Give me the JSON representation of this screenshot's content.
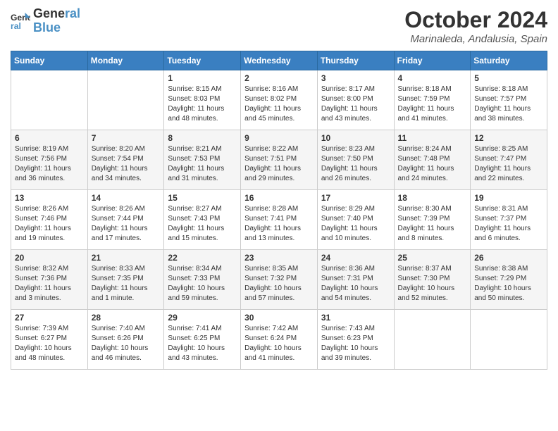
{
  "header": {
    "logo_line1": "General",
    "logo_line2": "Blue",
    "month": "October 2024",
    "location": "Marinaleda, Andalusia, Spain"
  },
  "days_of_week": [
    "Sunday",
    "Monday",
    "Tuesday",
    "Wednesday",
    "Thursday",
    "Friday",
    "Saturday"
  ],
  "weeks": [
    [
      {
        "day": "",
        "info": ""
      },
      {
        "day": "",
        "info": ""
      },
      {
        "day": "1",
        "info": "Sunrise: 8:15 AM\nSunset: 8:03 PM\nDaylight: 11 hours and 48 minutes."
      },
      {
        "day": "2",
        "info": "Sunrise: 8:16 AM\nSunset: 8:02 PM\nDaylight: 11 hours and 45 minutes."
      },
      {
        "day": "3",
        "info": "Sunrise: 8:17 AM\nSunset: 8:00 PM\nDaylight: 11 hours and 43 minutes."
      },
      {
        "day": "4",
        "info": "Sunrise: 8:18 AM\nSunset: 7:59 PM\nDaylight: 11 hours and 41 minutes."
      },
      {
        "day": "5",
        "info": "Sunrise: 8:18 AM\nSunset: 7:57 PM\nDaylight: 11 hours and 38 minutes."
      }
    ],
    [
      {
        "day": "6",
        "info": "Sunrise: 8:19 AM\nSunset: 7:56 PM\nDaylight: 11 hours and 36 minutes."
      },
      {
        "day": "7",
        "info": "Sunrise: 8:20 AM\nSunset: 7:54 PM\nDaylight: 11 hours and 34 minutes."
      },
      {
        "day": "8",
        "info": "Sunrise: 8:21 AM\nSunset: 7:53 PM\nDaylight: 11 hours and 31 minutes."
      },
      {
        "day": "9",
        "info": "Sunrise: 8:22 AM\nSunset: 7:51 PM\nDaylight: 11 hours and 29 minutes."
      },
      {
        "day": "10",
        "info": "Sunrise: 8:23 AM\nSunset: 7:50 PM\nDaylight: 11 hours and 26 minutes."
      },
      {
        "day": "11",
        "info": "Sunrise: 8:24 AM\nSunset: 7:48 PM\nDaylight: 11 hours and 24 minutes."
      },
      {
        "day": "12",
        "info": "Sunrise: 8:25 AM\nSunset: 7:47 PM\nDaylight: 11 hours and 22 minutes."
      }
    ],
    [
      {
        "day": "13",
        "info": "Sunrise: 8:26 AM\nSunset: 7:46 PM\nDaylight: 11 hours and 19 minutes."
      },
      {
        "day": "14",
        "info": "Sunrise: 8:26 AM\nSunset: 7:44 PM\nDaylight: 11 hours and 17 minutes."
      },
      {
        "day": "15",
        "info": "Sunrise: 8:27 AM\nSunset: 7:43 PM\nDaylight: 11 hours and 15 minutes."
      },
      {
        "day": "16",
        "info": "Sunrise: 8:28 AM\nSunset: 7:41 PM\nDaylight: 11 hours and 13 minutes."
      },
      {
        "day": "17",
        "info": "Sunrise: 8:29 AM\nSunset: 7:40 PM\nDaylight: 11 hours and 10 minutes."
      },
      {
        "day": "18",
        "info": "Sunrise: 8:30 AM\nSunset: 7:39 PM\nDaylight: 11 hours and 8 minutes."
      },
      {
        "day": "19",
        "info": "Sunrise: 8:31 AM\nSunset: 7:37 PM\nDaylight: 11 hours and 6 minutes."
      }
    ],
    [
      {
        "day": "20",
        "info": "Sunrise: 8:32 AM\nSunset: 7:36 PM\nDaylight: 11 hours and 3 minutes."
      },
      {
        "day": "21",
        "info": "Sunrise: 8:33 AM\nSunset: 7:35 PM\nDaylight: 11 hours and 1 minute."
      },
      {
        "day": "22",
        "info": "Sunrise: 8:34 AM\nSunset: 7:33 PM\nDaylight: 10 hours and 59 minutes."
      },
      {
        "day": "23",
        "info": "Sunrise: 8:35 AM\nSunset: 7:32 PM\nDaylight: 10 hours and 57 minutes."
      },
      {
        "day": "24",
        "info": "Sunrise: 8:36 AM\nSunset: 7:31 PM\nDaylight: 10 hours and 54 minutes."
      },
      {
        "day": "25",
        "info": "Sunrise: 8:37 AM\nSunset: 7:30 PM\nDaylight: 10 hours and 52 minutes."
      },
      {
        "day": "26",
        "info": "Sunrise: 8:38 AM\nSunset: 7:29 PM\nDaylight: 10 hours and 50 minutes."
      }
    ],
    [
      {
        "day": "27",
        "info": "Sunrise: 7:39 AM\nSunset: 6:27 PM\nDaylight: 10 hours and 48 minutes."
      },
      {
        "day": "28",
        "info": "Sunrise: 7:40 AM\nSunset: 6:26 PM\nDaylight: 10 hours and 46 minutes."
      },
      {
        "day": "29",
        "info": "Sunrise: 7:41 AM\nSunset: 6:25 PM\nDaylight: 10 hours and 43 minutes."
      },
      {
        "day": "30",
        "info": "Sunrise: 7:42 AM\nSunset: 6:24 PM\nDaylight: 10 hours and 41 minutes."
      },
      {
        "day": "31",
        "info": "Sunrise: 7:43 AM\nSunset: 6:23 PM\nDaylight: 10 hours and 39 minutes."
      },
      {
        "day": "",
        "info": ""
      },
      {
        "day": "",
        "info": ""
      }
    ]
  ]
}
